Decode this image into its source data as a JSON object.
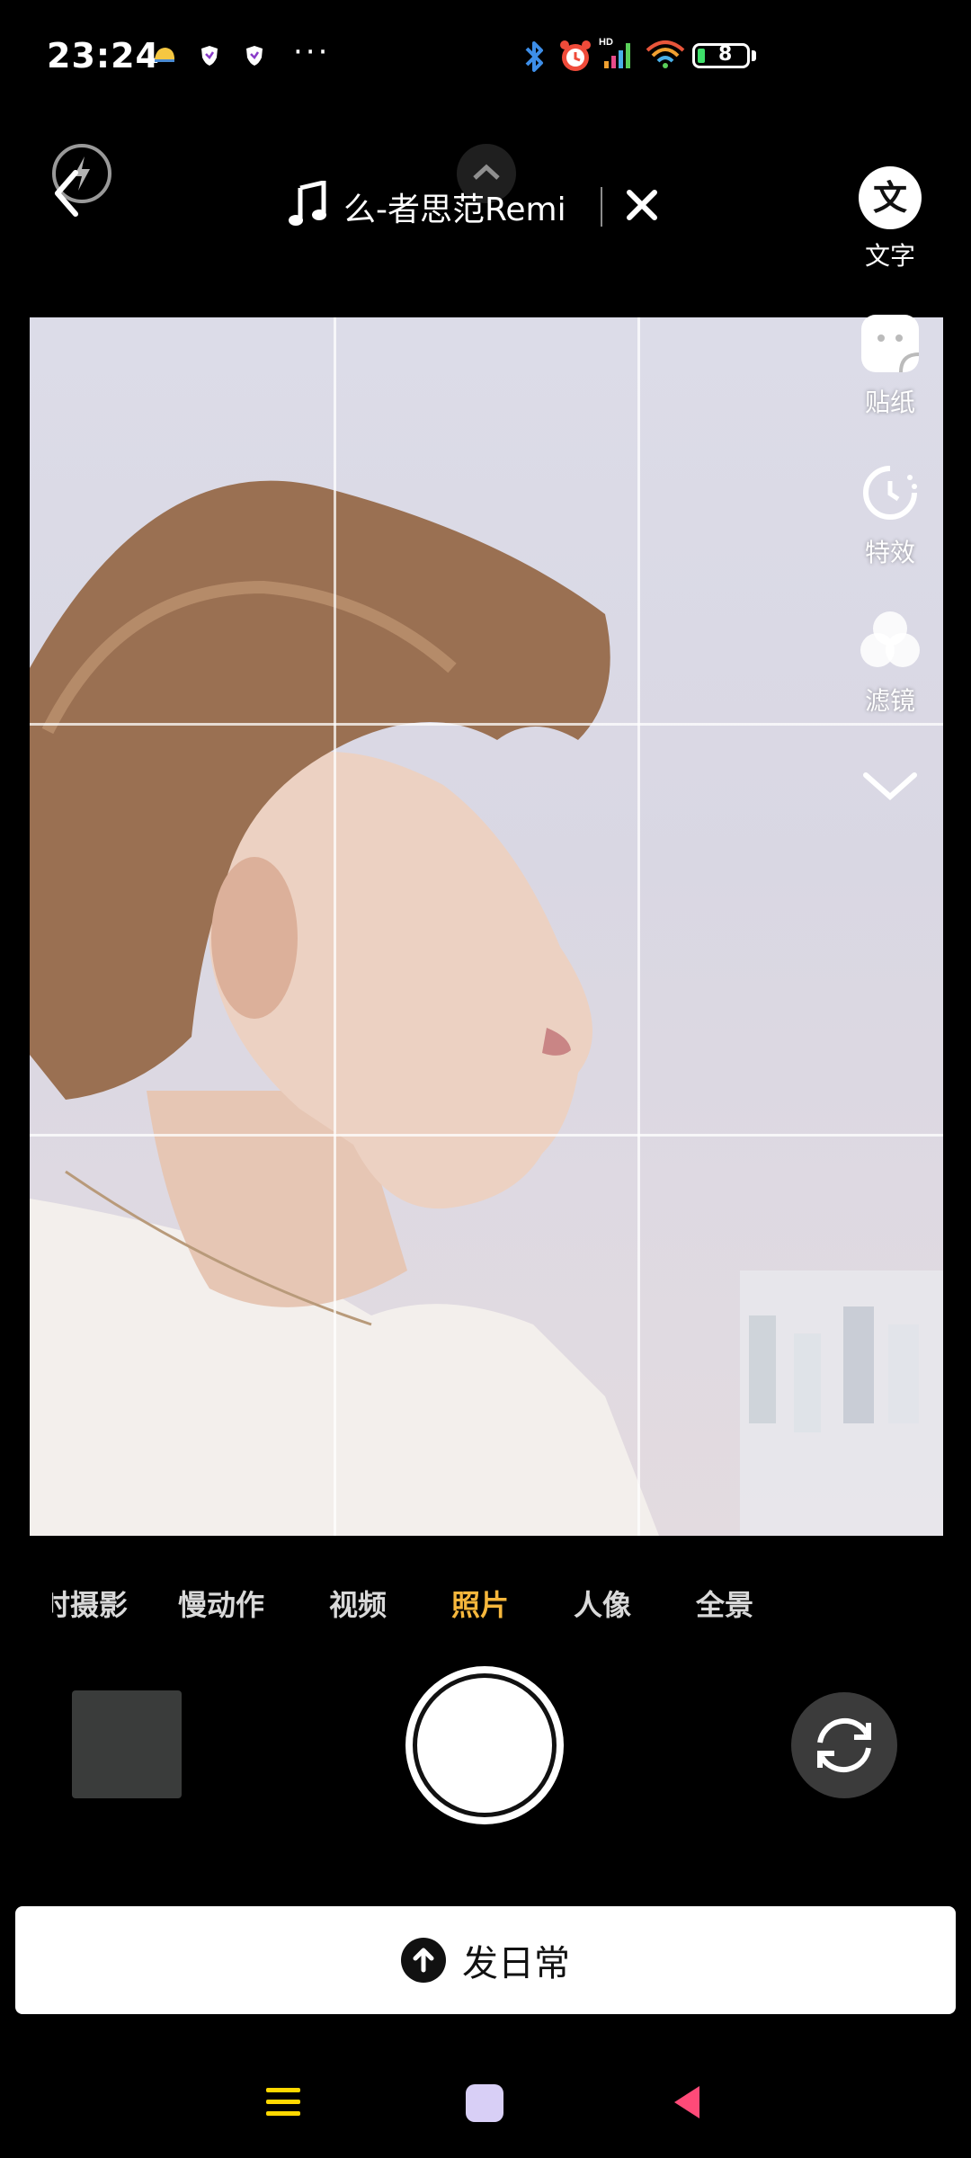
{
  "status_bar": {
    "time": "23:24",
    "more": "···",
    "battery_level": "8",
    "colors": {
      "battery_fill": "#3ee06a"
    },
    "icons": [
      "helmet-icon",
      "shield-icon",
      "shield-icon",
      "bluetooth-icon",
      "alarm-icon",
      "signal-hd-icon",
      "wifi-icon",
      "battery-icon"
    ]
  },
  "top_bar": {
    "music_title": "么-者思范Remi",
    "icons": {
      "back": "back-arrow-icon",
      "flash": "flash-icon",
      "music": "music-note-icon",
      "close": "close-icon",
      "expand": "chevron-up-icon"
    }
  },
  "right_tools": [
    {
      "label": "文字",
      "glyph": "文"
    },
    {
      "label": "贴纸"
    },
    {
      "label": "特效"
    },
    {
      "label": "滤镜"
    }
  ],
  "modes": [
    "延时摄影",
    "慢动作",
    "视频",
    "照片",
    "人像",
    "全景"
  ],
  "active_mode": "照片",
  "colors": {
    "active_mode": "#f6b73c",
    "nav_menu": "#ffd800",
    "nav_home": "#d8cff6",
    "nav_back": "#ff4a78"
  },
  "post_button": {
    "label": "发日常"
  }
}
